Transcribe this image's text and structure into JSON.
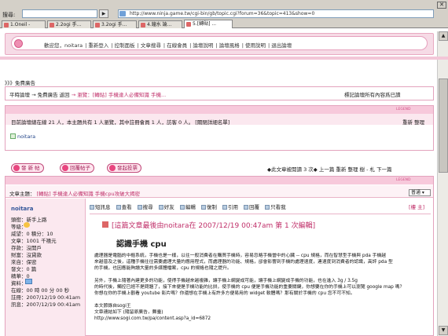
{
  "browser": {
    "search_label": "搜尋:",
    "search_go": "▶",
    "url": "http://www.ninja.game.tw/cgi-bin/gb/topic.cgi?forum=36&topic=413&show=0",
    "close": "✕",
    "tabs": [
      {
        "label": "1.Oneil -",
        "active": false
      },
      {
        "label": "2.2ogi 手...",
        "active": false
      },
      {
        "label": "3.2ogi 手...",
        "active": false
      },
      {
        "label": "4.鐘水 論...",
        "active": false
      },
      {
        "label": "5.[轉貼] ...",
        "active": true
      }
    ]
  },
  "header": {
    "links": [
      "歡迎您，noitara",
      "重新登入",
      "控制面板",
      "文章搜尋",
      "在線會員",
      "論壇說明",
      "論壇風格",
      "使用說明",
      "退出論壇"
    ]
  },
  "ad": {
    "title": "》》》免費廣告"
  },
  "breadcrumb": {
    "prefix": "平時論壇 → 免費廣告",
    "back": "返回",
    "trail": "→ 瀏覽：[轉貼] 手機達人必備知識  手機...",
    "time_note": "標記論壇所有內容爲已讀"
  },
  "online": {
    "legend": "LEGEND",
    "stats": "目前論壇總在線 21 人，本主題共有 1 人瀏覽，其中註冊會員 1 人，訪客 0 人。  [關閉詳細名單]",
    "refresh": "重新  整理",
    "user": "noitara"
  },
  "actions": {
    "post": "發 新 帖",
    "reply": "回覆帖子",
    "poll": "發起投票",
    "nav": "◆此文章被閱讀 3 次◆   上一篇    重新  整理  樹 - 札    下一篇"
  },
  "thread": {
    "legend": "LEGEND",
    "subject_label": "文章主題：",
    "subject": "[轉貼] 手機達人必備知識  手機cpu攻破大揭密",
    "sort": "普通 ▾",
    "author": "noitara",
    "author_info": [
      "頭銜：新手上路",
      "等級：",
      "威望：0   積分：10",
      "文章：1001 千禧元",
      "存款：沒開戶",
      "財富：沒貸款",
      "來自：保密",
      "發文：0 篇",
      "精華：0",
      "資料：",
      "在線：00 時 00 分 00 秒",
      "註冊：2007/12/19 00:41am",
      "訊息：2007/12/19 00:41am"
    ],
    "toolbar": [
      "短訊息",
      "查看",
      "搜尋",
      "好友",
      "編輯",
      "復制",
      "引用",
      "回覆",
      "只看我"
    ],
    "report": "[樓 主]",
    "meta_bracket": "[這篇文章最後由",
    "meta_user": "noitara",
    "meta_rest": "在 2007/12/19 00:47am 第 1 次編輯]",
    "post_title": "認識手機 cpu",
    "body": [
      "處理器是電腦的中樞系統，手機也是一樣，以往一般消費者在購買手機時，容易忽略手機當中的心臟 -- cpu 規格，而在智慧型手機與 pda 手機越",
      "來越普及之後，這種手機往往需要處理大量的應用程式，而處理器的功能、規格，卻會影響到手機的處理速度，連速度到消費者的認識，高評 pda 型",
      "的手機，也因應能夠讀大量的多媒體檔案，cpu 的規格也隨之提升。",
      "",
      "另外，手機上隨著內建更多的功能，使得手機越來越複雜，讓手機上網變成可能，讓手機上網變成手機的功能，也在進入 3g / 3.5g",
      "的時代後，觸控已經不是問題了，接下來便是手機功能的比拼，使手機的 cpu 便是手機功能的重要關鍵，你想要在你的手機上可以瀏覽 google map 嗎？",
      "你想在你的手機上觀看 youtube 影片嗎？你還想在手機上有許多方便易用的 widget 軟體嗎？那有關於手機的 cpu 您不可不知。",
      "",
      "本文節錄自sogi王",
      "文章連結如下 (隨留原廣告，舞臺)",
      "http://www.sogi.com.tw/pa/content.asp?a_id=6872"
    ]
  }
}
